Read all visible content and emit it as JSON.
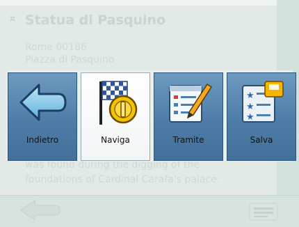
{
  "background": {
    "hash_mark": "¤",
    "title": "Statua di Pasquino",
    "line1": "Rome 00186",
    "line2": "Piazza di Pasquino",
    "line3": "was found during the digging of the",
    "line4": "foundations of Cardinal Carafa's palace."
  },
  "menu": {
    "items": [
      {
        "label": "Indietro",
        "icon": "back-arrow-icon"
      },
      {
        "label": "Naviga",
        "icon": "checkered-flag-icon"
      },
      {
        "label": "Tramite",
        "icon": "via-checklist-icon"
      },
      {
        "label": "Salva",
        "icon": "save-list-icon"
      }
    ],
    "selected_index": 1
  },
  "colors": {
    "button_blue": "#4d7da8",
    "button_selected": "#f2f4f5",
    "background": "#e2e9e6"
  }
}
